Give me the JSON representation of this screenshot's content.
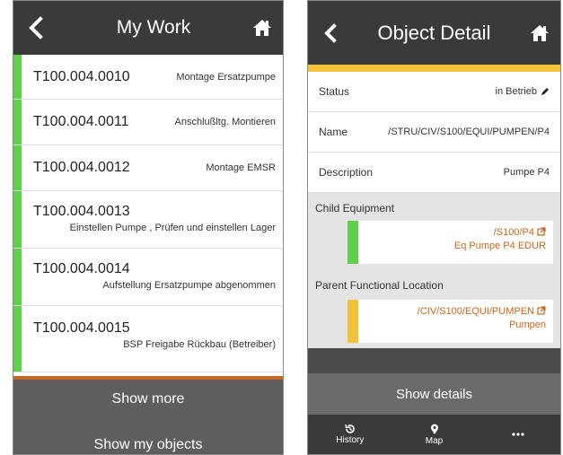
{
  "left_screen": {
    "header": {
      "title": "My Work"
    },
    "work_items": [
      {
        "code": "T100.004.0010",
        "description": "Montage Ersatzpumpe"
      },
      {
        "code": "T100.004.0011",
        "description": "Anschlußltg. Montieren"
      },
      {
        "code": "T100.004.0012",
        "description": "Montage EMSR"
      },
      {
        "code": "T100.004.0013",
        "description": "Einstellen Pumpe , Prüfen und einstellen Lager"
      },
      {
        "code": "T100.004.0014",
        "description": "Aufstellung Ersatzpumpe abgenommen"
      },
      {
        "code": "T100.004.0015",
        "description": "BSP Freigabe Rückbau (Betreiber)"
      }
    ],
    "buttons": {
      "show_more": "Show more",
      "show_my_objects": "Show my objects"
    }
  },
  "right_screen": {
    "header": {
      "title": "Object Detail"
    },
    "fields": {
      "status_label": "Status",
      "status_value": "in Betrieb",
      "name_label": "Name",
      "name_value": "/STRU/CIV/S100/EQUI/PUMPEN/P4",
      "description_label": "Description",
      "description_value": "Pumpe P4"
    },
    "child_equipment": {
      "title": "Child Equipment",
      "path": "/S100/P4",
      "name": "Eq Pumpe P4 EDUR"
    },
    "parent_functional_location": {
      "title": "Parent Functional Location",
      "path": "/CIV/S100/EQUI/PUMPEN",
      "name": "Pumpen"
    },
    "show_details": "Show details",
    "tabs": [
      {
        "label": "History",
        "icon": "history-icon"
      },
      {
        "label": "Map",
        "icon": "map-pin-icon"
      },
      {
        "label": "",
        "icon": "more-icon"
      }
    ]
  },
  "colors": {
    "header_bg": "#3a3a3a",
    "status_green": "#5ed14a",
    "status_yellow": "#f2c33a",
    "link_orange": "#c8661f",
    "button_gray": "#5e5e5e"
  },
  "icons": [
    "back-chevron-icon",
    "home-icon",
    "pencil-icon",
    "external-link-icon",
    "history-icon",
    "map-pin-icon",
    "more-icon"
  ]
}
